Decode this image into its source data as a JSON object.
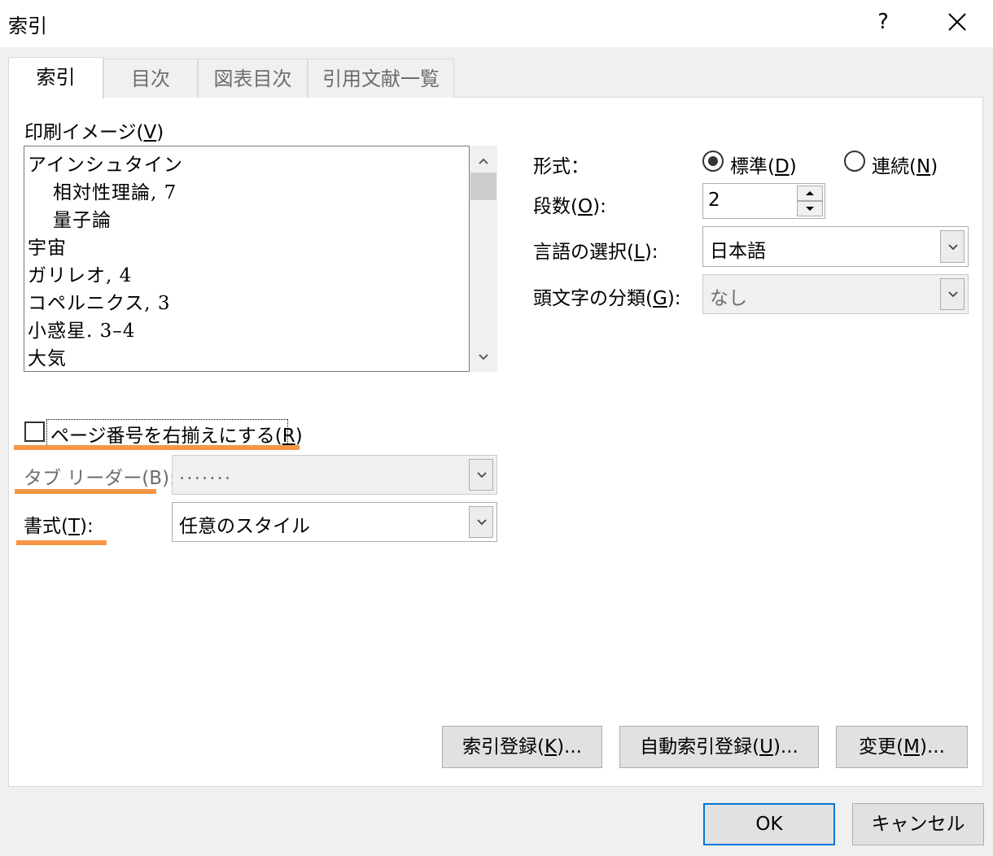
{
  "window": {
    "title": "索引",
    "help_label": "?",
    "close_icon": "close-icon"
  },
  "tabs": [
    {
      "label": "索引",
      "active": true
    },
    {
      "label": "目次",
      "active": false
    },
    {
      "label": "図表目次",
      "active": false
    },
    {
      "label": "引用文献一覧",
      "active": false
    }
  ],
  "preview": {
    "label": "印刷イメージ(",
    "label_key": "V",
    "label_end": ")",
    "lines": [
      "アインシュタイン",
      "相対性理論, 7",
      "量子論",
      "宇宙",
      "ガリレオ, 4",
      "コペルニクス, 3",
      "小惑星. 3–4",
      "大気"
    ]
  },
  "right_align": {
    "label": "ページ番号を右揃えにする(",
    "key": "R",
    "end": ")",
    "checked": false
  },
  "tab_leader": {
    "label": "タブ リーダー(B):",
    "value": "......."
  },
  "format": {
    "label_pre": "書式(",
    "key": "T",
    "label_post": "):",
    "value": "任意のスタイル"
  },
  "layout_type": {
    "label": "形式：",
    "options": [
      {
        "pre": "標準(",
        "key": "D",
        "post": ")",
        "selected": true
      },
      {
        "pre": "連続(",
        "key": "N",
        "post": ")",
        "selected": false
      }
    ]
  },
  "columns": {
    "label_pre": "段数(",
    "key": "O",
    "label_post": "):",
    "value": "2"
  },
  "language": {
    "label_pre": "言語の選択(",
    "key": "L",
    "label_post": "):",
    "value": "日本語"
  },
  "headings": {
    "label_pre": "頭文字の分類(",
    "key": "G",
    "label_post": "):",
    "value": "なし"
  },
  "buttons": {
    "mark_entry": {
      "pre": "索引登録(",
      "key": "K",
      "post": ")..."
    },
    "automark": {
      "pre": "自動索引登録(",
      "key": "U",
      "post": ")..."
    },
    "modify": {
      "pre": "変更(",
      "key": "M",
      "post": ")..."
    },
    "ok": "OK",
    "cancel": "キャンセル"
  },
  "colors": {
    "highlight": "#f79646",
    "accent": "#0078d7"
  }
}
